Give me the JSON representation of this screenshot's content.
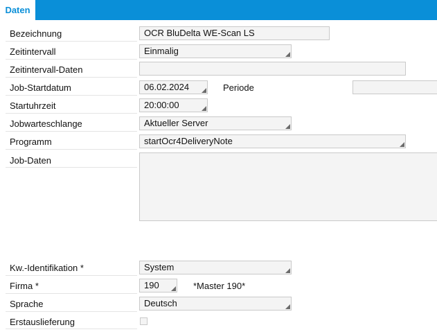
{
  "tabs": [
    {
      "label": "Daten",
      "active": true
    }
  ],
  "form": {
    "bezeichnung": {
      "label": "Bezeichnung",
      "value": "OCR BluDelta WE-Scan LS"
    },
    "zeitintervall": {
      "label": "Zeitintervall",
      "value": "Einmalig"
    },
    "zeitintervall_daten": {
      "label": "Zeitintervall-Daten",
      "value": ""
    },
    "job_startdatum": {
      "label": "Job-Startdatum",
      "value": "06.02.2024"
    },
    "periode": {
      "label": "Periode",
      "value": ""
    },
    "startuhrzeit": {
      "label": "Startuhrzeit",
      "value": "20:00:00"
    },
    "jobwarteschlange": {
      "label": "Jobwarteschlange",
      "value": "Aktueller Server"
    },
    "programm": {
      "label": "Programm",
      "value": "startOcr4DeliveryNote"
    },
    "job_daten": {
      "label": "Job-Daten",
      "value": ""
    },
    "kw_identifikation": {
      "label": "Kw.-Identifikation *",
      "value": "System"
    },
    "firma": {
      "label": "Firma *",
      "value": "190",
      "description": "*Master 190*"
    },
    "sprache": {
      "label": "Sprache",
      "value": "Deutsch"
    },
    "erstauslieferung": {
      "label": "Erstauslieferung",
      "checked": false
    }
  },
  "colors": {
    "accent": "#0a8fd8",
    "field_bg": "#f4f4f4",
    "field_border": "#c9c9c9"
  }
}
